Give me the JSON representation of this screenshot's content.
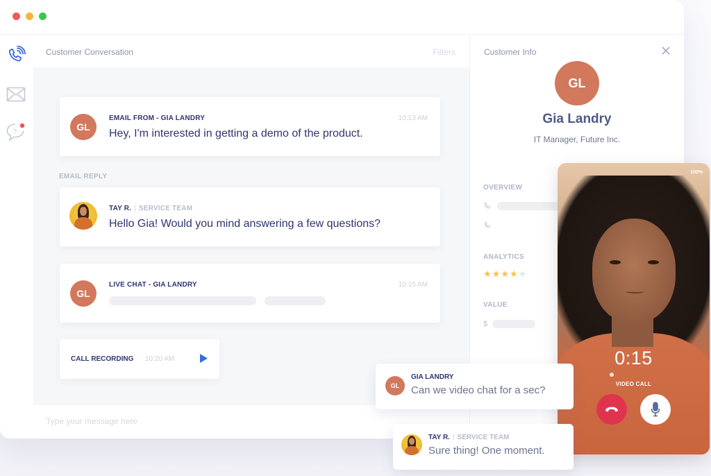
{
  "window": {
    "controls": [
      "close",
      "minimize",
      "maximize"
    ]
  },
  "sidebar": {
    "items": [
      {
        "name": "phone",
        "icon": "phone-ringing-icon",
        "active": true
      },
      {
        "name": "email",
        "icon": "mail-icon",
        "active": false
      },
      {
        "name": "chat",
        "icon": "help-chat-icon",
        "active": false,
        "notification": true
      }
    ]
  },
  "conversation": {
    "title": "Customer Conversation",
    "filters_label": "Filters",
    "items": [
      {
        "type": "email",
        "avatar": "GL",
        "sender": "EMAIL FROM - GIA LANDRY",
        "time": "10:13 AM",
        "message": "Hey, I'm interested in getting a demo of the product."
      },
      {
        "section_label": "EMAIL REPLY",
        "sender": "TAY R.",
        "team": "SERVICE TEAM",
        "message": "Hello Gia! Would you mind answering a few questions?"
      },
      {
        "type": "live-chat",
        "avatar": "GL",
        "sender": "LIVE CHAT - GIA LANDRY",
        "time": "10:15 AM"
      },
      {
        "type": "call-recording",
        "label": "CALL RECORDING",
        "time": "10:20 AM"
      }
    ],
    "composer_placeholder": "Type your message here"
  },
  "customer_info": {
    "title": "Customer Info",
    "avatar": "GL",
    "name": "Gia Landry",
    "role": "IT Manager, Future Inc.",
    "overview_label": "OVERVIEW",
    "analytics_label": "ANALYTICS",
    "rating": 4,
    "rating_max": 5,
    "value_label": "VALUE",
    "currency_symbol": "$"
  },
  "video_call": {
    "quality": "100%",
    "timer": "0:15",
    "label": "VIDEO CALL"
  },
  "chat_bubbles": [
    {
      "avatar": "GL",
      "name": "GIA LANDRY",
      "text": "Can we video chat for a sec?"
    },
    {
      "name": "TAY R.",
      "team": "SERVICE TEAM",
      "text": "Sure thing! One moment."
    }
  ],
  "colors": {
    "accent_blue": "#2f6fe0",
    "avatar_orange": "#d2785c",
    "hangup_red": "#e0344e",
    "star_yellow": "#f6c634",
    "text_navy": "#2f3470"
  }
}
